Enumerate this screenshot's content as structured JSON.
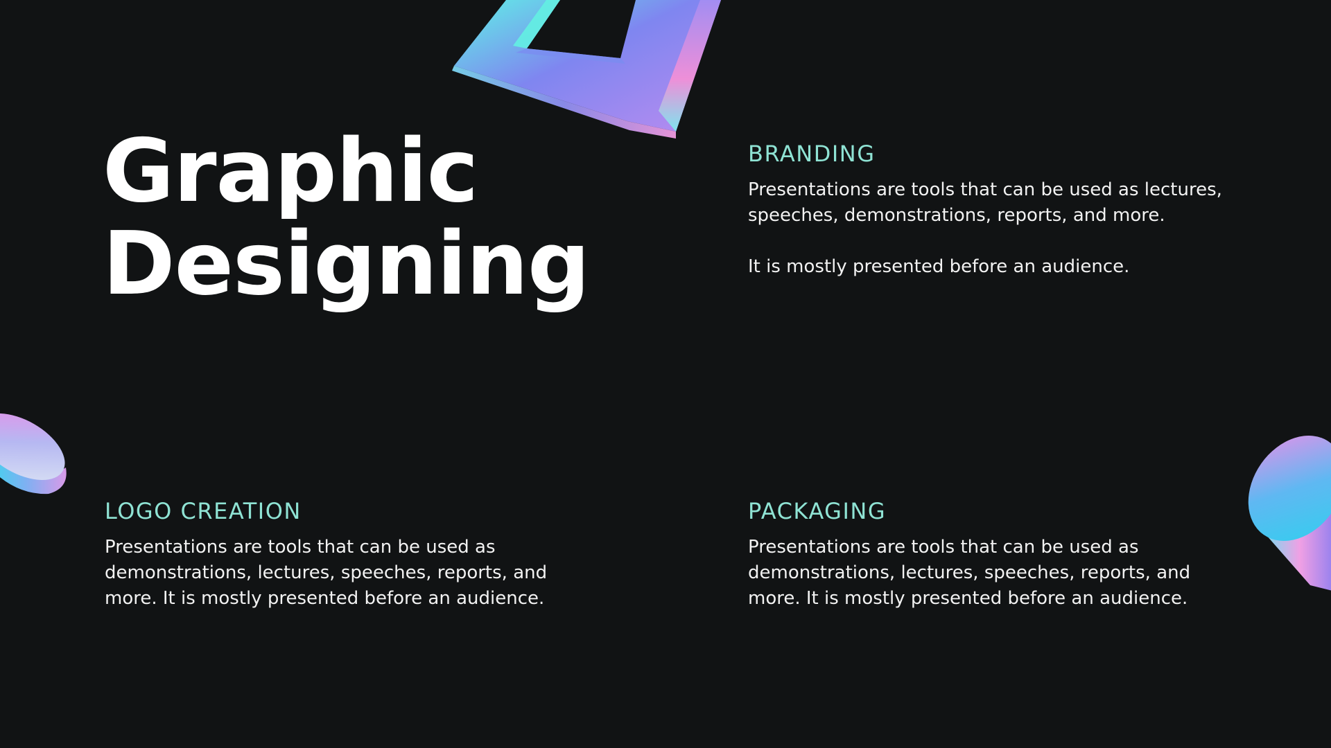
{
  "slide": {
    "title_line1": "Graphic",
    "title_line2": "Designing",
    "background_color": "#111314",
    "accent_color": "#8fe3d4"
  },
  "sections": {
    "branding": {
      "heading": "BRANDING",
      "paragraph1": "Presentations are tools that can be used as lectures, speeches, demonstrations, reports, and more.",
      "paragraph2": "It is mostly presented before an audience."
    },
    "logo_creation": {
      "heading": "LOGO CREATION",
      "paragraph1": "Presentations are tools that can be used as demonstrations, lectures, speeches, reports, and more. It is mostly presented before an audience."
    },
    "packaging": {
      "heading": "PACKAGING",
      "paragraph1": "Presentations are tools that can be used as demonstrations, lectures, speeches, reports, and more. It is mostly presented before an audience."
    }
  },
  "decorations": [
    {
      "name": "holographic-frame-shape"
    },
    {
      "name": "holographic-disc-left-shape"
    },
    {
      "name": "holographic-cylinder-right-shape"
    }
  ]
}
